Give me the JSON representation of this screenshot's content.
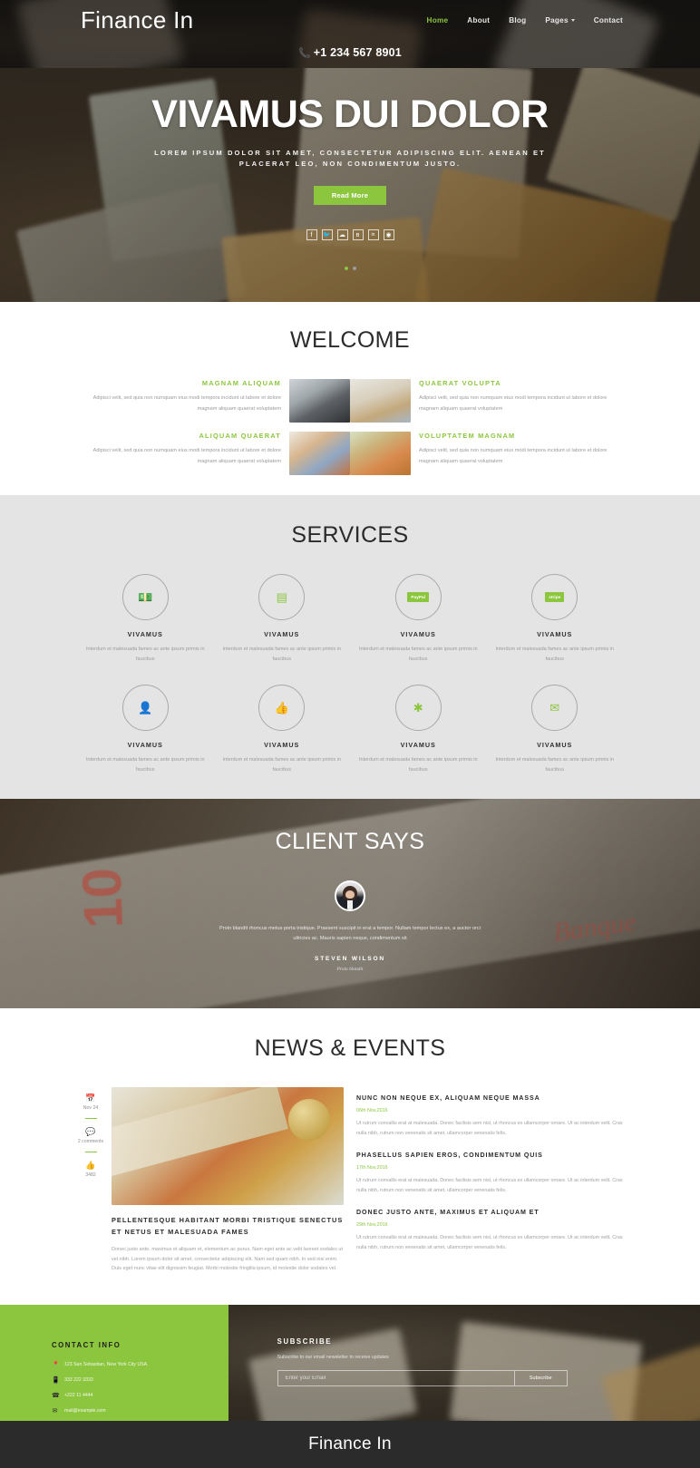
{
  "header": {
    "brand": "Finance In",
    "nav": [
      {
        "label": "Home",
        "active": true,
        "caret": false
      },
      {
        "label": "About",
        "active": false,
        "caret": false
      },
      {
        "label": "Blog",
        "active": false,
        "caret": false
      },
      {
        "label": "Pages",
        "active": false,
        "caret": true
      },
      {
        "label": "Contact",
        "active": false,
        "caret": false
      }
    ],
    "phone": "+1 234 567 8901",
    "phone_icon": "phone-volume-icon"
  },
  "hero": {
    "title": "VIVAMUS DUI DOLOR",
    "subtitle": "LOREM IPSUM DOLOR SIT AMET, CONSECTETUR ADIPISCING ELIT. AENEAN ET PLACERAT LEO, NON CONDIMENTUM JUSTO.",
    "button": "Read More",
    "social": [
      {
        "name": "facebook-icon",
        "glyph": "f"
      },
      {
        "name": "twitter-icon",
        "glyph": "✉"
      },
      {
        "name": "rss-icon",
        "glyph": "◤"
      },
      {
        "name": "vk-icon",
        "glyph": "В"
      },
      {
        "name": "linkedin-icon",
        "glyph": "in"
      },
      {
        "name": "instagram-icon",
        "glyph": "◎"
      }
    ],
    "slides": [
      {
        "active": false
      },
      {
        "active": true
      }
    ],
    "accent_color": "#8cc63e"
  },
  "welcome": {
    "title": "WELCOME",
    "items": [
      {
        "heading": "MAGNAM ALIQUAM",
        "text": "Adipisci velit, sed quia non numquam eius modi tempora incidunt ut labore et dolore magnam aliquam quaerat voluptatem",
        "image": "point-of-sale-terminal-photo",
        "side": "left"
      },
      {
        "heading": "QUAERAT VOLUPTA",
        "text": "Adipisci velit, sed quia non numquam eius modi tempora incidunt ut labore et dolore magnam aliquam quaerat voluptatem",
        "image": "euro-banknotes-on-desk-photo",
        "side": "right"
      },
      {
        "heading": "ALIQUAM QUAERAT",
        "text": "Adipisci velit, sed quia non numquam eius modi tempora incidunt ut labore et dolore magnam aliquam quaerat voluptatem",
        "image": "shopping-groceries-photo",
        "side": "left"
      },
      {
        "heading": "VOLUPTATEM MAGNAM",
        "text": "Adipisci velit, sed quia non numquam eius modi tempora incidunt ut labore et dolore magnam aliquam quaerat voluptatem",
        "image": "euro-notes-and-coins-photo",
        "side": "right"
      }
    ]
  },
  "services": {
    "title": "SERVICES",
    "items": [
      {
        "icon": "money-bill-icon",
        "glyph": "💵",
        "chip": "",
        "name": "VIVAMUS",
        "desc": "Interdum et malesuada fames ac ante ipsum primis in faucibus"
      },
      {
        "icon": "credit-card-icon",
        "glyph": "▤",
        "chip": "",
        "name": "VIVAMUS",
        "desc": "Interdum et malesuada fames ac ante ipsum primis in faucibus"
      },
      {
        "icon": "paypal-icon",
        "glyph": "",
        "chip": "PayPal",
        "name": "VIVAMUS",
        "desc": "Interdum et malesuada fames ac ante ipsum primis in faucibus"
      },
      {
        "icon": "stripe-icon",
        "glyph": "",
        "chip": "stripe",
        "name": "VIVAMUS",
        "desc": "Interdum et malesuada fames ac ante ipsum primis in faucibus"
      },
      {
        "icon": "user-icon",
        "glyph": "👤",
        "chip": "",
        "name": "VIVAMUS",
        "desc": "Interdum et malesuada fames ac ante ipsum primis in faucibus"
      },
      {
        "icon": "thumbs-up-icon",
        "glyph": "👍",
        "chip": "",
        "name": "VIVAMUS",
        "desc": "Interdum et malesuada fames ac ante ipsum primis in faucibus"
      },
      {
        "icon": "asterisk-icon",
        "glyph": "✱",
        "chip": "",
        "name": "VIVAMUS",
        "desc": "Interdum et malesuada fames ac ante ipsum primis in faucibus"
      },
      {
        "icon": "envelope-icon",
        "glyph": "✉",
        "chip": "",
        "name": "VIVAMUS",
        "desc": "Interdum et malesuada fames ac ante ipsum primis in faucibus"
      }
    ]
  },
  "client": {
    "title": "CLIENT SAYS",
    "avatar": "client-avatar-photo",
    "quote": "Proin blandit rhoncus metus porta tristique. Praesent suscipit in erat a tempor. Nullam tempor lectus ex, a auctor orci ultricies ac. Mauris sapien neque, condimentum sit",
    "name": "STEVEN WILSON",
    "role": "Proin blandit"
  },
  "news": {
    "title": "NEWS & EVENTS",
    "meta": [
      {
        "icon": "calendar-icon",
        "glyph": "📅",
        "text": "Nov 24"
      },
      {
        "icon": "comment-icon",
        "glyph": "💬",
        "text": "2 comments"
      },
      {
        "icon": "thumbs-up-icon",
        "glyph": "👍",
        "text": "3482"
      }
    ],
    "feature": {
      "image": "euro-banknotes-and-coins-photo",
      "title": "PELLENTESQUE HABITANT MORBI TRISTIQUE SENECTUS ET NETUS ET MALESUADA FAMES",
      "text": "Donec justo ante, maximus et aliquam et, elementum ac purus. Nam eget ante ac velit laoreet sodales ut vel nibh. Lorem ipsum dolor sit amet, consectetur adipiscing elit. Nam sed quam nibh. In sed nisi enim. Duis eget nunc vitae elit dignissim feugiat. Morbi molestie fringilla ipsum, id molestie dolor sodales vel."
    },
    "posts": [
      {
        "title": "NUNC NON NEQUE EX, ALIQUAM NEQUE MASSA",
        "date": "06th Nov,2016",
        "text": "Ut rutrum convallis erat at malesuada. Donec facilisis sem nisl, ut rhoncus ex ullamcorper ornare. Ut ac interdum velit. Cras nulla nibh, rutrum non venenatis sit amet, ullamcorper venenatis felis."
      },
      {
        "title": "PHASELLUS SAPIEN EROS, CONDIMENTUM QUIS",
        "date": "17th Nov,2016",
        "text": "Ut rutrum convallis erat at malesuada. Donec facilisis sem nisl, ut rhoncus ex ullamcorper ornare. Ut ac interdum velit. Cras nulla nibh, rutrum non venenatis sit amet, ullamcorper venenatis felis."
      },
      {
        "title": "DONEC JUSTO ANTE, MAXIMUS ET ALIQUAM ET",
        "date": "29th Nov,2016",
        "text": "Ut rutrum convallis erat at malesuada. Donec facilisis sem nisl, ut rhoncus ex ullamcorper ornare. Ut ac interdum velit. Cras nulla nibh, rutrum non venenatis sit amet, ullamcorper venenatis felis."
      }
    ]
  },
  "contact": {
    "title": "CONTACT INFO",
    "background_color": "#8cc63e",
    "lines": [
      {
        "icon": "map-marker-icon",
        "glyph": "📍",
        "text": "123 San Sebastian, New York City USA."
      },
      {
        "icon": "mobile-icon",
        "glyph": "☐",
        "text": "333 222 3333"
      },
      {
        "icon": "phone-icon",
        "glyph": "☎",
        "text": "+222 11 4444"
      },
      {
        "icon": "envelope-icon",
        "glyph": "✉",
        "text": "mail@example.com"
      }
    ]
  },
  "subscribe": {
    "title": "SUBSCRIBE",
    "description": "Subscribe to our email newsletter to receive updates",
    "placeholder": "Enter your Email",
    "value": "",
    "button": "Subscribe"
  },
  "footer": {
    "brand": "Finance In"
  }
}
